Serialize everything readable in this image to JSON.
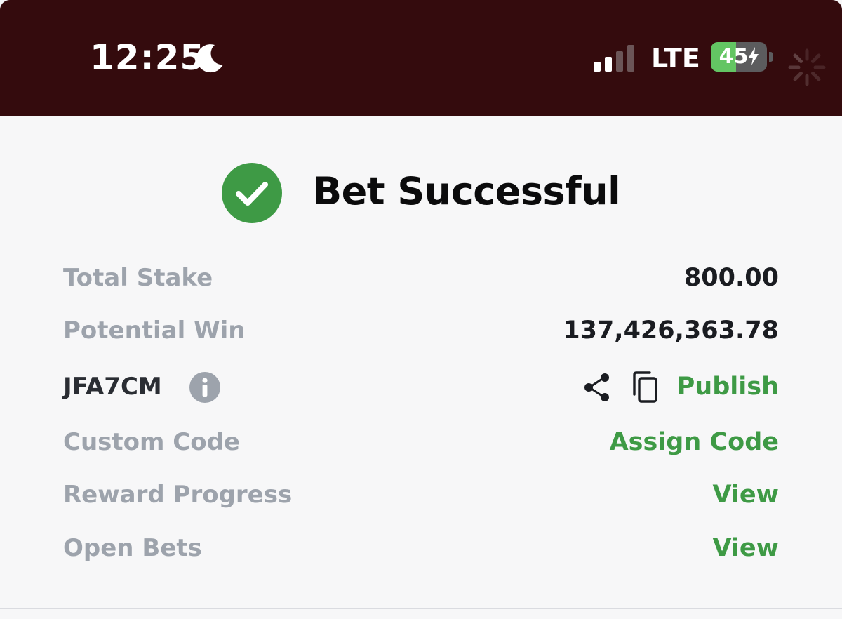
{
  "status_bar": {
    "time": "12:25",
    "network": "LTE",
    "battery_percent": 45,
    "battery_text": "45",
    "moon_icon": "moon-icon",
    "signal_icon": "cellular-signal-icon",
    "charging_icon": "lightning-bolt-icon",
    "loading_icon": "spinner-icon"
  },
  "header": {
    "title": "Bet Successful",
    "icon": "check-circle-icon",
    "icon_color": "#3e9a45"
  },
  "details": {
    "total_stake": {
      "label": "Total Stake",
      "value": "800.00"
    },
    "potential_win": {
      "label": "Potential Win",
      "value": "137,426,363.78"
    },
    "booking_code": {
      "code": "JFA7CM",
      "info_icon": "info-icon",
      "share_icon": "share-icon",
      "copy_icon": "copy-icon",
      "action": "Publish"
    },
    "custom_code": {
      "label": "Custom Code",
      "action": "Assign Code"
    },
    "reward_progress": {
      "label": "Reward Progress",
      "action": "View"
    },
    "open_bets": {
      "label": "Open Bets",
      "action": "View"
    }
  },
  "colors": {
    "status_bar_bg": "#340b0d",
    "accent_green": "#3e9a45",
    "label_gray": "#9da3ac",
    "value_dark": "#1a1c21",
    "battery_green": "#63c563"
  }
}
